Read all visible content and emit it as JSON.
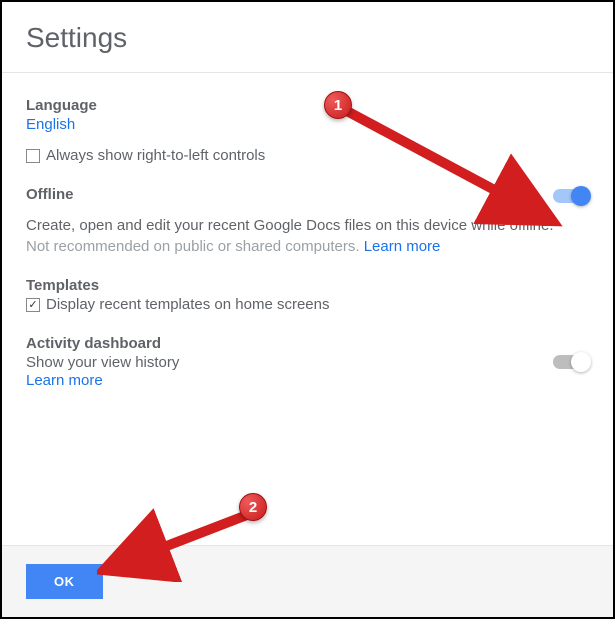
{
  "header": {
    "title": "Settings"
  },
  "language": {
    "heading": "Language",
    "value": "English",
    "rtl_checkbox_label": "Always show right-to-left controls",
    "rtl_checked": false
  },
  "offline": {
    "heading": "Offline",
    "toggle_on": true,
    "description": "Create, open and edit your recent Google Docs files on this device while offline.",
    "note": "Not recommended on public or shared computers.",
    "learn_more": "Learn more"
  },
  "templates": {
    "heading": "Templates",
    "checkbox_label": "Display recent templates on home screens",
    "checked": true
  },
  "activity": {
    "heading": "Activity dashboard",
    "description": "Show your view history",
    "learn_more": "Learn more",
    "toggle_on": false
  },
  "footer": {
    "ok_label": "OK"
  },
  "callouts": {
    "one": "1",
    "two": "2"
  }
}
